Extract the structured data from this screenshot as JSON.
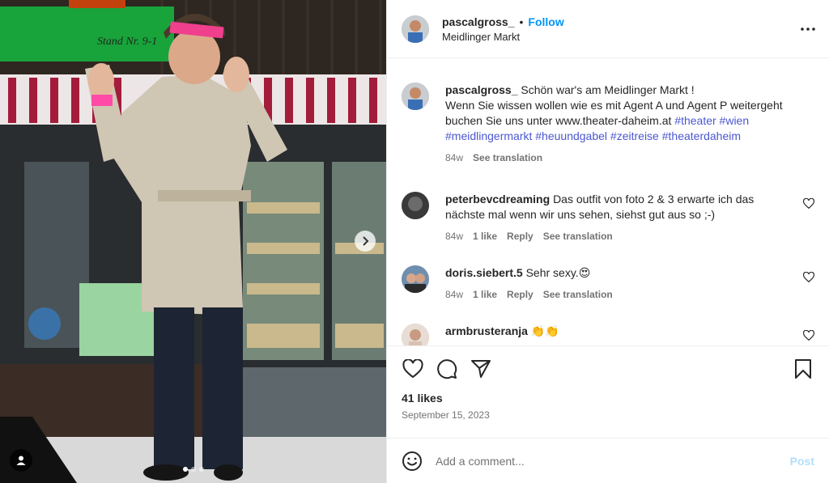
{
  "post": {
    "author": "pascalgross_",
    "follow_label": "Follow",
    "separator": "•",
    "location": "Meidlinger Markt",
    "more_icon": "more-horizontal-icon"
  },
  "photo": {
    "sign_text": "Stand Nr. 9-1",
    "carousel_dots": 3,
    "active_dot": 0
  },
  "caption": {
    "username": "pascalgross_",
    "text_lines": [
      "Schön war's am Meidlinger Markt !",
      "Wenn Sie wissen wollen wie es mit Agent A und Agent P weitergeht buchen Sie uns unter www.theater-daheim.at"
    ],
    "hashtags": [
      "#theater",
      "#wien",
      "#meidlingermarkt",
      "#heuundgabel",
      "#zeitreise",
      "#theaterdaheim"
    ],
    "time": "84w",
    "see_translation": "See translation"
  },
  "comments": [
    {
      "username": "peterbevcdreaming",
      "text": "Das outfit von foto 2 & 3 erwarte ich das nächste mal wenn wir uns sehen, siehst gut aus so ;-)",
      "time": "84w",
      "likes": "1 like",
      "reply": "Reply",
      "see_translation": "See translation"
    },
    {
      "username": "doris.siebert.5",
      "text": "Sehr sexy.😍",
      "time": "84w",
      "likes": "1 like",
      "reply": "Reply",
      "see_translation": "See translation"
    },
    {
      "username": "armbrusteranja",
      "text": "👏👏",
      "time": "",
      "likes": "",
      "reply": "",
      "see_translation": ""
    }
  ],
  "engagement": {
    "likes": "41 likes",
    "date": "September 15, 2023"
  },
  "add_comment": {
    "placeholder": "Add a comment...",
    "post_label": "Post"
  },
  "colors": {
    "link_blue": "#0095f6",
    "hashtag": "#4b57d1",
    "muted": "#737373",
    "post_disabled": "#b2dffc"
  }
}
